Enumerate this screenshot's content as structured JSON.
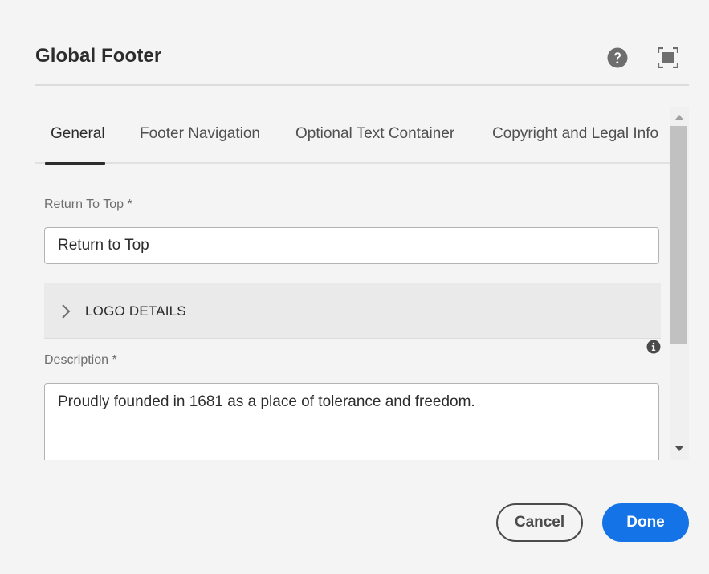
{
  "dialog": {
    "title": "Global Footer",
    "icons": {
      "help": "help-circle-icon",
      "fullscreen": "fullscreen-icon"
    }
  },
  "tabs": [
    {
      "label": "General",
      "active": true
    },
    {
      "label": "Footer Navigation",
      "active": false
    },
    {
      "label": "Optional Text Container",
      "active": false
    },
    {
      "label": "Copyright and Legal Info",
      "active": false
    }
  ],
  "form": {
    "return_to_top": {
      "label": "Return To Top *",
      "value": "Return to Top"
    },
    "logo_details": {
      "label": "LOGO DETAILS",
      "expanded": false
    },
    "description": {
      "label": "Description *",
      "value": "Proudly founded in 1681 as a place of tolerance and freedom."
    }
  },
  "footer": {
    "cancel_label": "Cancel",
    "done_label": "Done"
  },
  "colors": {
    "accent": "#1473e6",
    "background": "#f4f4f4"
  }
}
